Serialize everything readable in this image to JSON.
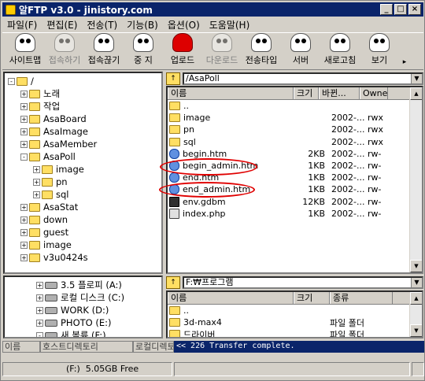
{
  "window": {
    "title": "알FTP v3.0 - jinistory.com",
    "min": "_",
    "max": "□",
    "close": "×"
  },
  "menu": [
    "파일(F)",
    "편집(E)",
    "전송(T)",
    "기능(B)",
    "옵션(O)",
    "도움말(H)"
  ],
  "toolbar": [
    {
      "label": "사이트맵",
      "icon": "sitemap-icon",
      "enabled": true
    },
    {
      "label": "접속하기",
      "icon": "connect-icon",
      "enabled": false
    },
    {
      "label": "접속끊기",
      "icon": "disconnect-icon",
      "enabled": true
    },
    {
      "label": "중 지",
      "icon": "stop-icon",
      "enabled": true
    },
    {
      "label": "업로드",
      "icon": "upload-icon",
      "enabled": true
    },
    {
      "label": "다운로드",
      "icon": "download-icon",
      "enabled": false
    },
    {
      "label": "전송타입",
      "icon": "transfer-type-icon",
      "enabled": true
    },
    {
      "label": "서버",
      "icon": "server-icon",
      "enabled": true
    },
    {
      "label": "새로고침",
      "icon": "refresh-icon",
      "enabled": true
    },
    {
      "label": "보기",
      "icon": "view-icon",
      "enabled": true
    }
  ],
  "remote_tree": {
    "root": "/",
    "items": [
      {
        "label": "노래",
        "depth": 1,
        "pm": "+"
      },
      {
        "label": "작업",
        "depth": 1,
        "pm": "+"
      },
      {
        "label": "AsaBoard",
        "depth": 1,
        "pm": "+"
      },
      {
        "label": "AsaImage",
        "depth": 1,
        "pm": "+"
      },
      {
        "label": "AsaMember",
        "depth": 1,
        "pm": "+"
      },
      {
        "label": "AsaPoll",
        "depth": 1,
        "pm": "-"
      },
      {
        "label": "image",
        "depth": 2,
        "pm": "+"
      },
      {
        "label": "pn",
        "depth": 2,
        "pm": "+"
      },
      {
        "label": "sql",
        "depth": 2,
        "pm": "+"
      },
      {
        "label": "AsaStat",
        "depth": 1,
        "pm": "+"
      },
      {
        "label": "down",
        "depth": 1,
        "pm": "+"
      },
      {
        "label": "guest",
        "depth": 1,
        "pm": "+"
      },
      {
        "label": "image",
        "depth": 1,
        "pm": "+"
      },
      {
        "label": "v3u0424s",
        "depth": 1,
        "pm": "+"
      }
    ]
  },
  "remote_path": "/AsaPoll",
  "remote_cols": [
    "이름",
    "크기",
    "바뀐...",
    "Owne"
  ],
  "remote_files": [
    {
      "name": "..",
      "size": "",
      "date": "",
      "owner": "",
      "type": "folder"
    },
    {
      "name": "image",
      "size": "",
      "date": "2002-...",
      "owner": "rwx",
      "type": "folder"
    },
    {
      "name": "pn",
      "size": "",
      "date": "2002-...",
      "owner": "rwx",
      "type": "folder"
    },
    {
      "name": "sql",
      "size": "",
      "date": "2002-...",
      "owner": "rwx",
      "type": "folder"
    },
    {
      "name": "begin.htm",
      "size": "2KB",
      "date": "2002-...",
      "owner": "rw-",
      "type": "htm"
    },
    {
      "name": "begin_admin.htm",
      "size": "1KB",
      "date": "2002-...",
      "owner": "rw-",
      "type": "htm"
    },
    {
      "name": "end.htm",
      "size": "1KB",
      "date": "2002-...",
      "owner": "rw-",
      "type": "htm"
    },
    {
      "name": "end_admin.htm",
      "size": "1KB",
      "date": "2002-...",
      "owner": "rw-",
      "type": "htm"
    },
    {
      "name": "env.gdbm",
      "size": "12KB",
      "date": "2002-...",
      "owner": "rw-",
      "type": "db"
    },
    {
      "name": "index.php",
      "size": "1KB",
      "date": "2002-...",
      "owner": "rw-",
      "type": "php"
    }
  ],
  "local_tree": [
    {
      "label": "3.5 플로피 (A:)",
      "pm": "+",
      "kind": "floppy"
    },
    {
      "label": "로컬 디스크 (C:)",
      "pm": "+",
      "kind": "drive"
    },
    {
      "label": "WORK (D:)",
      "pm": "+",
      "kind": "drive"
    },
    {
      "label": "PHOTO (E:)",
      "pm": "+",
      "kind": "drive"
    },
    {
      "label": "새 볼륨 (F:)",
      "pm": "-",
      "kind": "drive"
    }
  ],
  "local_path": "F:₩프로그램",
  "local_cols": [
    "이름",
    "크기",
    "종류"
  ],
  "local_files": [
    {
      "name": "..",
      "kind": ""
    },
    {
      "name": "3d-max4",
      "kind": "파일 폴더"
    },
    {
      "name": "드라이버",
      "kind": "파일 폴더"
    }
  ],
  "log_cols": [
    "이름",
    "호스트디렉토리",
    "로컬디렉토리"
  ],
  "log_line": "<< 226 Transfer complete.",
  "status": {
    "drive": "(F:)",
    "free": "5.05GB Free"
  },
  "colors": {
    "title_bg": "#0a246a",
    "highlight": "#e00000",
    "folder": "#ffdf63"
  }
}
